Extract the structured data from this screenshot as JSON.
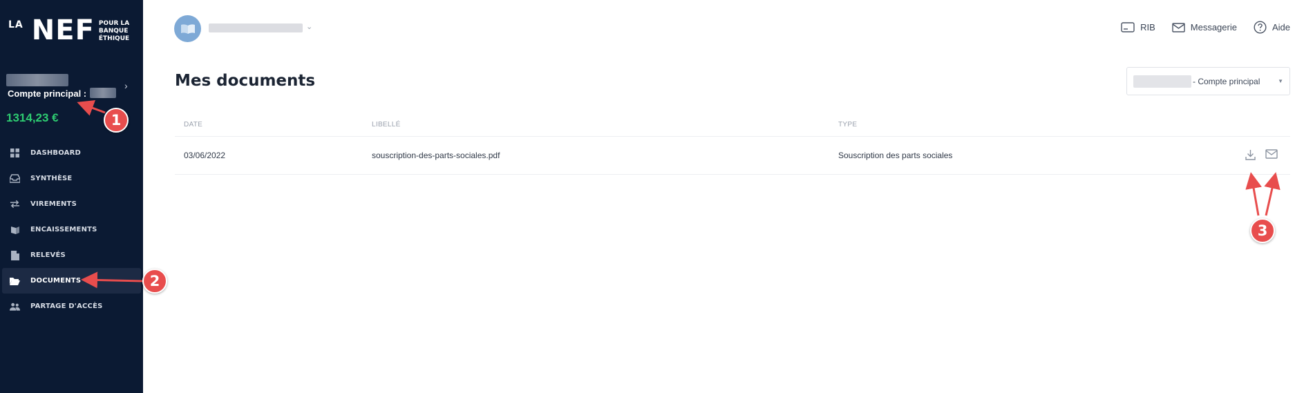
{
  "brand": {
    "logo_prefix": "LA",
    "logo_main": "NEF",
    "tagline": [
      "POUR LA",
      "BANQUE",
      "ÉTHIQUE"
    ]
  },
  "account": {
    "label": "Compte principal :",
    "balance": "1314,23 €"
  },
  "sidebar": {
    "items": [
      {
        "label": "DASHBOARD",
        "icon": "grid-icon",
        "active": false
      },
      {
        "label": "SYNTHÈSE",
        "icon": "inbox-icon",
        "active": false
      },
      {
        "label": "VIREMENTS",
        "icon": "transfer-icon",
        "active": false
      },
      {
        "label": "ENCAISSEMENTS",
        "icon": "cheque-icon",
        "active": false
      },
      {
        "label": "RELEVÉS",
        "icon": "file-icon",
        "active": false
      },
      {
        "label": "DOCUMENTS",
        "icon": "folder-icon",
        "active": true
      },
      {
        "label": "PARTAGE D'ACCÈS",
        "icon": "users-icon",
        "active": false
      }
    ]
  },
  "header": {
    "nav": [
      {
        "label": "RIB",
        "icon": "card-icon"
      },
      {
        "label": "Messagerie",
        "icon": "mail-icon"
      },
      {
        "label": "Aide",
        "icon": "help-icon"
      }
    ]
  },
  "main": {
    "title": "Mes documents",
    "account_select": "- Compte principal",
    "table": {
      "headers": {
        "date": "DATE",
        "libelle": "LIBELLÉ",
        "type": "TYPE"
      },
      "rows": [
        {
          "date": "03/06/2022",
          "libelle": "souscription-des-parts-sociales.pdf",
          "type": "Souscription des parts sociales"
        }
      ]
    }
  },
  "annotations": {
    "badges": [
      "1",
      "2",
      "3"
    ]
  },
  "colors": {
    "sidebar_bg": "#0b1a33",
    "balance": "#2ecc71",
    "annotation": "#e84d4d"
  }
}
